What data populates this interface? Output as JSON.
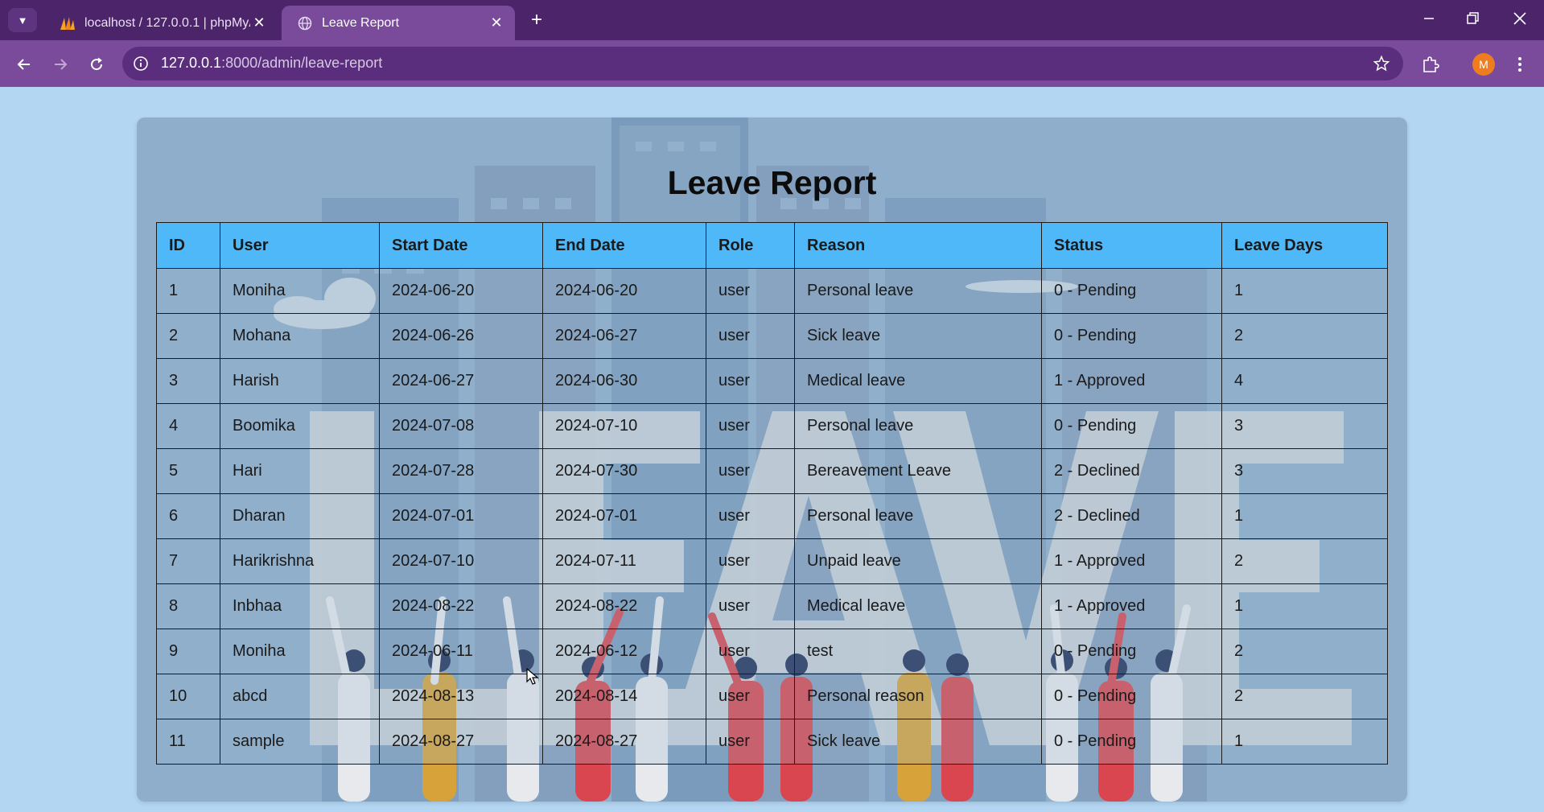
{
  "browser": {
    "tabs": [
      {
        "title": "localhost / 127.0.0.1 | phpMyAd",
        "active": false,
        "icon": "phpmyadmin-icon"
      },
      {
        "title": "Leave Report",
        "active": true,
        "icon": "globe-icon"
      }
    ],
    "url_host": "127.0.0.1",
    "url_path": ":8000/admin/leave-report",
    "profile_initial": "M",
    "colors": {
      "tab_strip": "#4b2469",
      "toolbar": "#7a4b9b",
      "avatar": "#ee7d22"
    }
  },
  "page": {
    "heading": "Leave Report",
    "background_art_text": "LEAVE",
    "columns": [
      "ID",
      "User",
      "Start Date",
      "End Date",
      "Role",
      "Reason",
      "Status",
      "Leave Days"
    ],
    "rows": [
      [
        "1",
        "Moniha",
        "2024-06-20",
        "2024-06-20",
        "user",
        "Personal leave",
        "0 - Pending",
        "1"
      ],
      [
        "2",
        "Mohana",
        "2024-06-26",
        "2024-06-27",
        "user",
        "Sick leave",
        "0 - Pending",
        "2"
      ],
      [
        "3",
        "Harish",
        "2024-06-27",
        "2024-06-30",
        "user",
        "Medical leave",
        "1 - Approved",
        "4"
      ],
      [
        "4",
        "Boomika",
        "2024-07-08",
        "2024-07-10",
        "user",
        "Personal leave",
        "0 - Pending",
        "3"
      ],
      [
        "5",
        "Hari",
        "2024-07-28",
        "2024-07-30",
        "user",
        "Bereavement Leave",
        "2 - Declined",
        "3"
      ],
      [
        "6",
        "Dharan",
        "2024-07-01",
        "2024-07-01",
        "user",
        "Personal leave",
        "2 - Declined",
        "1"
      ],
      [
        "7",
        "Harikrishna",
        "2024-07-10",
        "2024-07-11",
        "user",
        "Unpaid leave",
        "1 - Approved",
        "2"
      ],
      [
        "8",
        "Inbhaa",
        "2024-08-22",
        "2024-08-22",
        "user",
        "Medical leave",
        "1 - Approved",
        "1"
      ],
      [
        "9",
        "Moniha",
        "2024-06-11",
        "2024-06-12",
        "user",
        "test",
        "0 - Pending",
        "2"
      ],
      [
        "10",
        "abcd",
        "2024-08-13",
        "2024-08-14",
        "user",
        "Personal reason",
        "0 - Pending",
        "2"
      ],
      [
        "11",
        "sample",
        "2024-08-27",
        "2024-08-27",
        "user",
        "Sick leave",
        "0 - Pending",
        "1"
      ]
    ],
    "colors": {
      "header_bg": "#4fb8f8",
      "card_bg": "#8eaecb",
      "page_bg": "#b3d6f2"
    }
  }
}
